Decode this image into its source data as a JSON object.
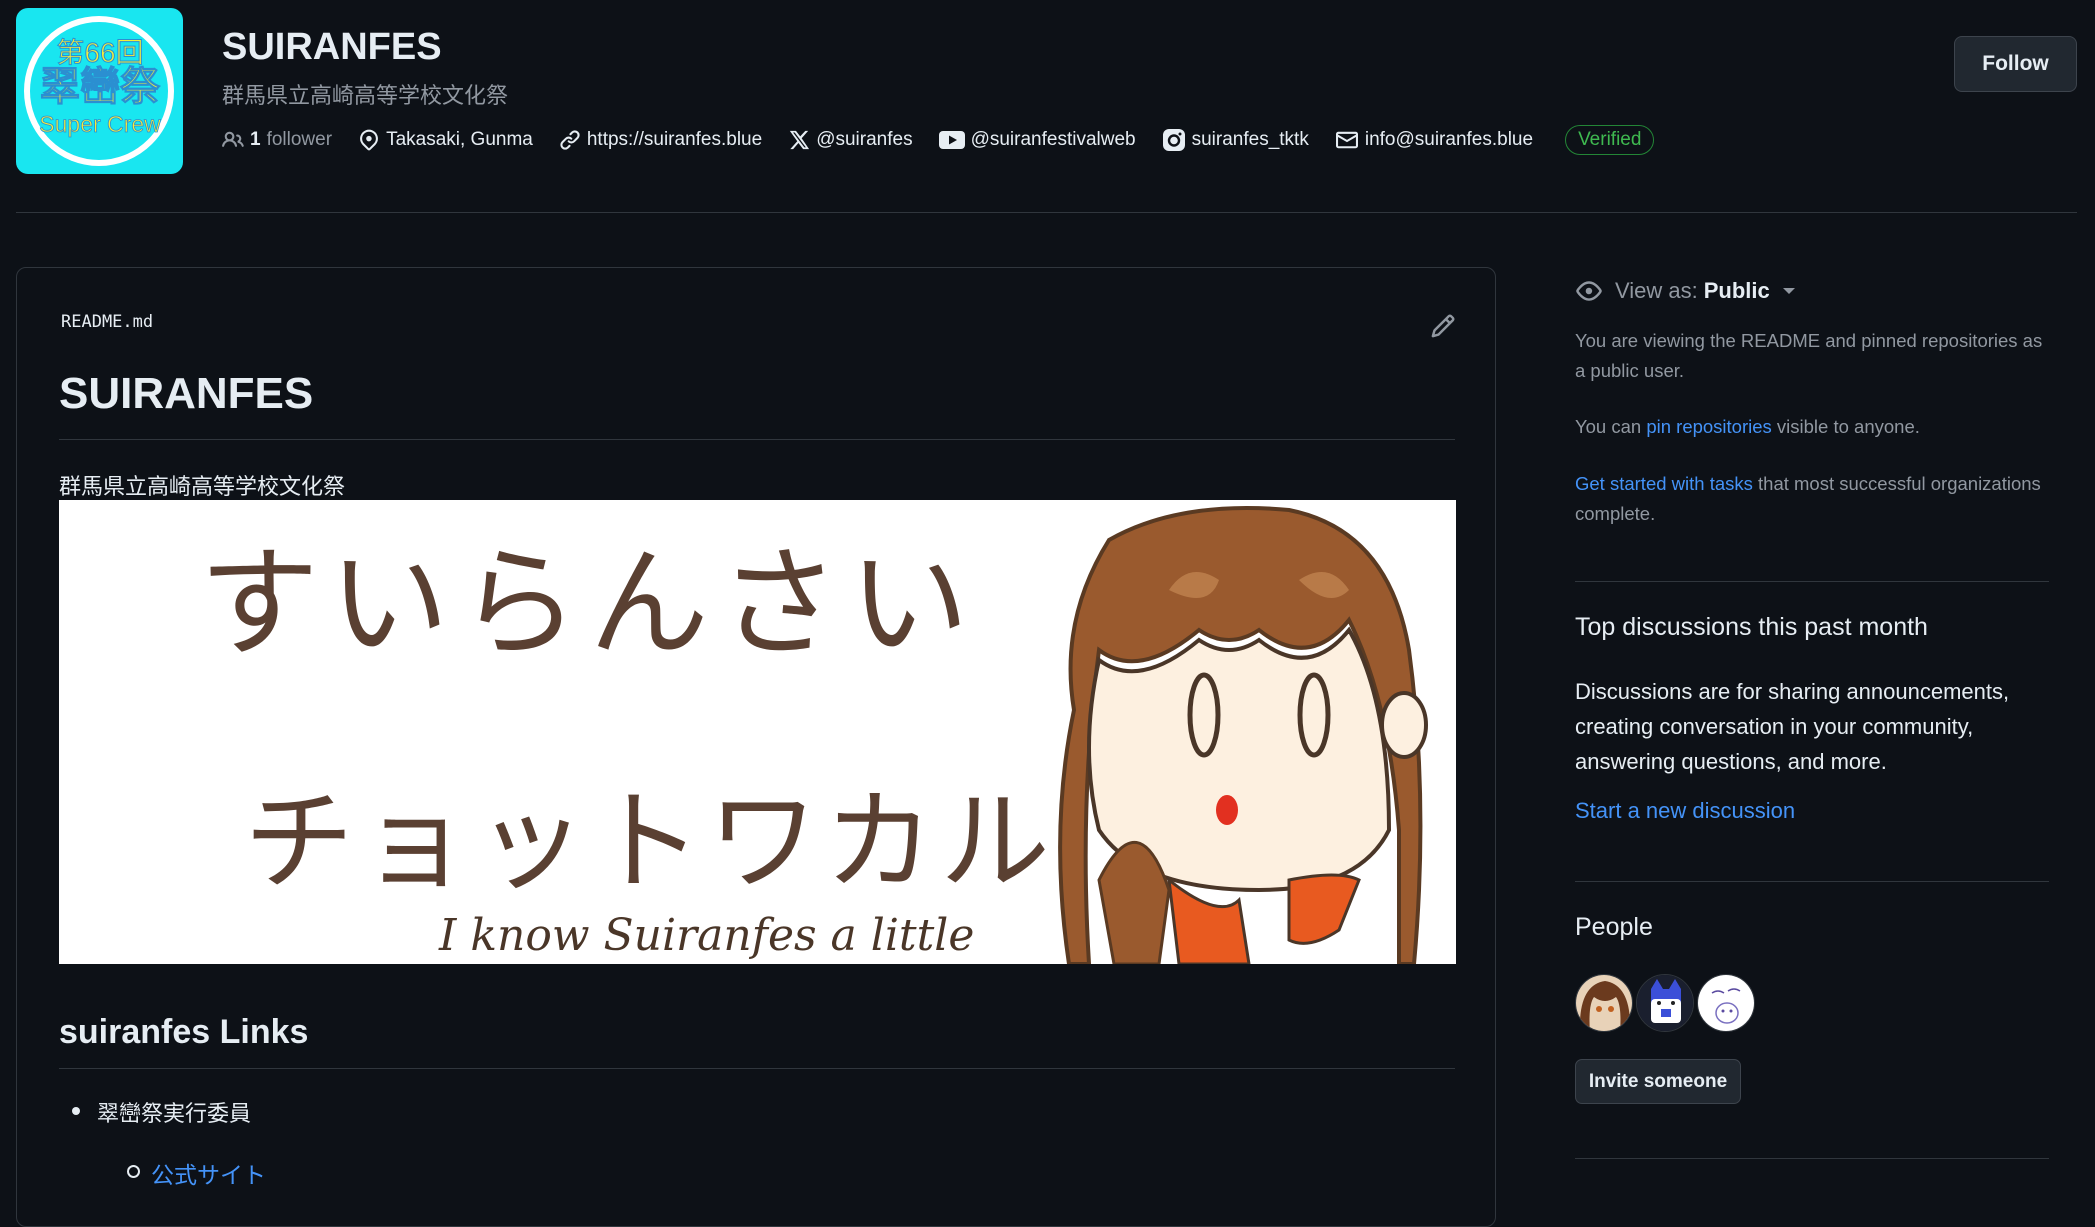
{
  "org": {
    "name": "SUIRANFES",
    "description": "群馬県立高崎高等学校文化祭",
    "avatar_text": {
      "line1": "第66回",
      "line2": "翠巒祭",
      "line3": "Super Crew"
    },
    "followers_count": "1",
    "followers_label": "follower",
    "location": "Takasaki, Gunma",
    "website": "https://suiranfes.blue",
    "x_handle": "@suiranfes",
    "youtube": "@suiranfestivalweb",
    "instagram": "suiranfes_tktk",
    "email": "info@suiranfes.blue",
    "verified_label": "Verified",
    "follow_label": "Follow"
  },
  "readme": {
    "filename": "README.md",
    "title": "SUIRANFES",
    "subtitle": "群馬県立高崎高等学校文化祭",
    "banner": {
      "line1": "すいらんさい",
      "line2": "チョットワカル",
      "line3": "I know Suiranfes a little"
    },
    "links_heading": "suiranfes Links",
    "list_item": "翠巒祭実行委員",
    "sub_link": "公式サイト"
  },
  "sidebar": {
    "view_as_label": "View as:",
    "view_as_value": "Public",
    "viewing_note": "You are viewing the README and pinned repositories as a public user.",
    "pin_prefix": "You can ",
    "pin_link": "pin repositories",
    "pin_suffix": " visible to anyone.",
    "tasks_link": "Get started with tasks",
    "tasks_suffix": " that most successful organizations complete.",
    "discussions_heading": "Top discussions this past month",
    "discussions_text": "Discussions are for sharing announcements, creating conversation in your community, answering questions, and more.",
    "discussions_link": "Start a new discussion",
    "people_heading": "People",
    "invite_label": "Invite someone"
  },
  "colors": {
    "background": "#0d1117",
    "border": "#30363d",
    "link": "#4493f8",
    "verified": "#3fb950",
    "avatar_bg": "#19e6f0",
    "avatar_text": "#f5ee3a"
  }
}
